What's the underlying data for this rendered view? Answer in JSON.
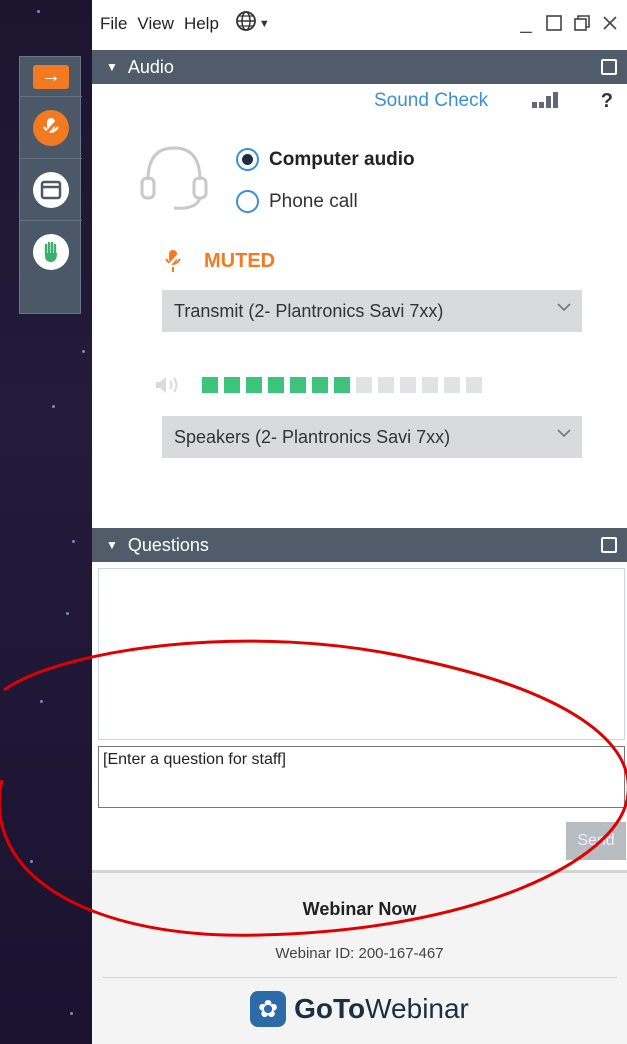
{
  "menubar": {
    "items": [
      "File",
      "View",
      "Help"
    ],
    "language_icon": "globe-icon"
  },
  "window_controls": [
    "minimize-icon",
    "restore-icon",
    "restore-down-icon",
    "close-icon"
  ],
  "control_strip": {
    "buttons": [
      "collapse-arrow-icon",
      "microphone-muted-icon",
      "window-icon",
      "raise-hand-icon"
    ]
  },
  "audio": {
    "header": "Audio",
    "sound_check": "Sound Check",
    "help": "?",
    "options": [
      {
        "label": "Computer audio",
        "selected": true
      },
      {
        "label": "Phone call",
        "selected": false
      }
    ],
    "mute_status": "MUTED",
    "microphone_select": "Transmit (2- Plantronics Savi 7xx)",
    "speaker_select": "Speakers (2- Plantronics Savi 7xx)",
    "speaker_level_on": 7,
    "speaker_level_total": 13
  },
  "questions": {
    "header": "Questions",
    "input_value": "[Enter a question for staff]",
    "send_label": "Send"
  },
  "footer": {
    "title": "Webinar Now",
    "webinar_id": "Webinar ID: 200-167-467",
    "brand_bold": "GoTo",
    "brand_rest": "Webinar"
  },
  "colors": {
    "accent_orange": "#f37a20",
    "link_blue": "#3c8fd1",
    "header_gray": "#505c6a",
    "level_green": "#3cc47a",
    "annotation_red": "#e00000"
  }
}
